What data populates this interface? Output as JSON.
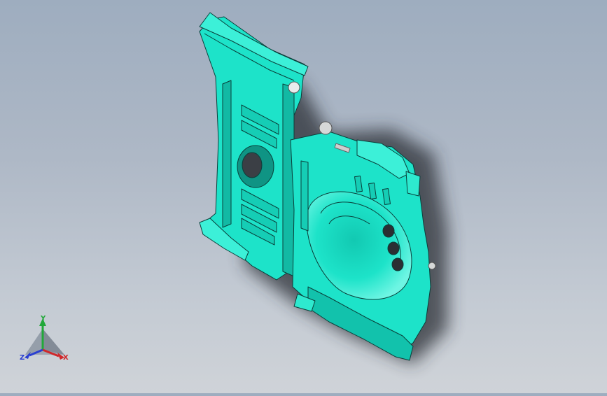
{
  "model": {
    "name": "",
    "color": "#1de3c9",
    "edge_color": "#0a3f3a"
  },
  "triad": {
    "x_label": "X",
    "y_label": "Y",
    "z_label": "Z",
    "x_color": "#d0282b",
    "y_color": "#22a83a",
    "z_color": "#2a3fd1"
  }
}
